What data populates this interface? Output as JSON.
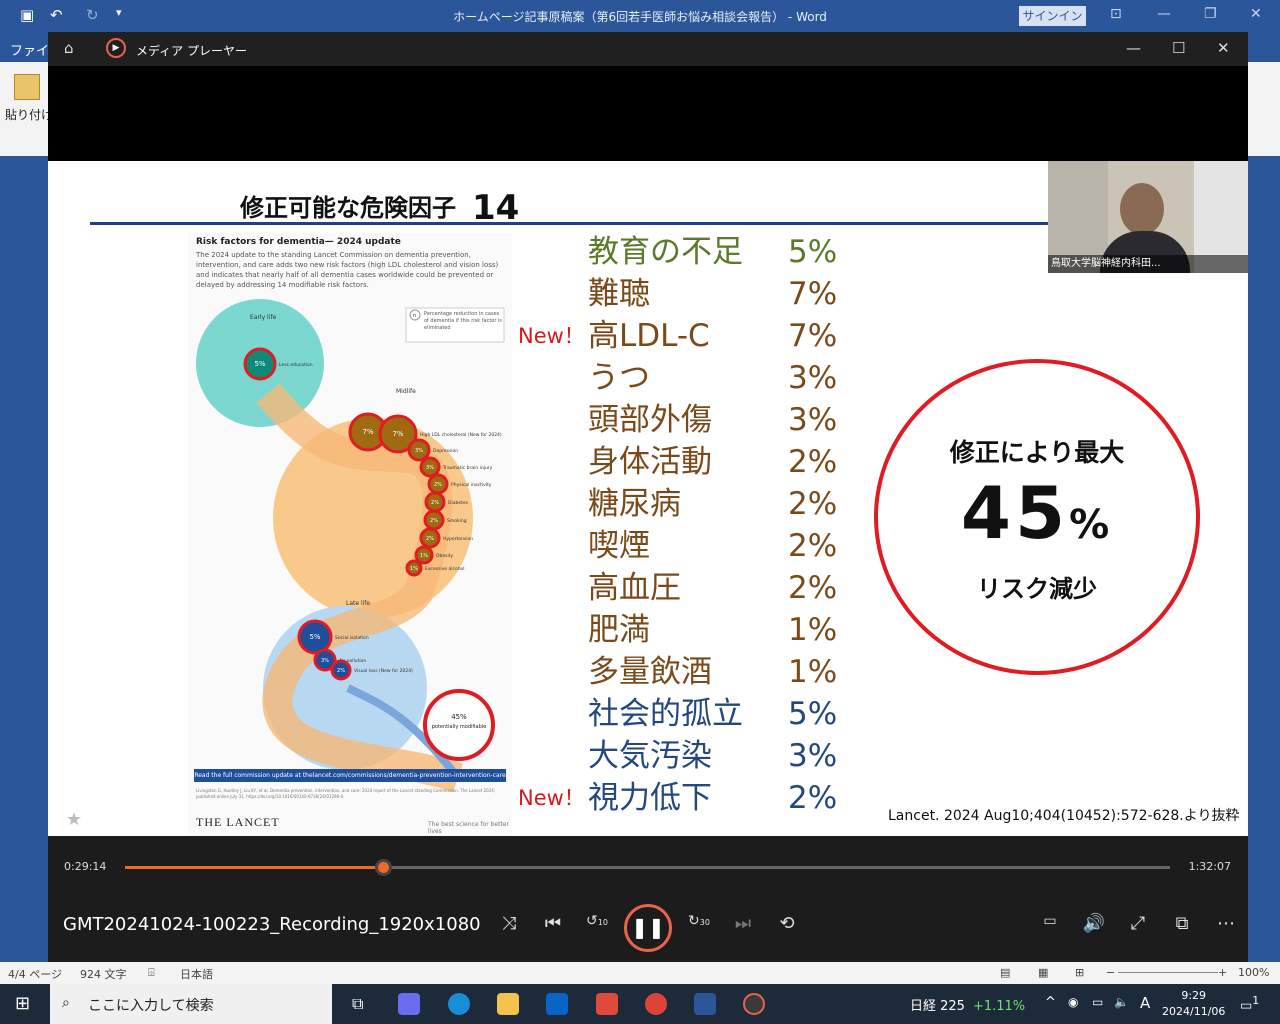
{
  "word": {
    "title": "ホームページ記事原稿案（第6回若手医師お悩み相談会報告） - Word",
    "signin": "サインイン",
    "tab_file": "ファイル",
    "paste_label": "貼り付け",
    "status": {
      "page": "4/4 ページ",
      "words": "924 文字",
      "lang": "日本語",
      "zoom": "100%"
    }
  },
  "player": {
    "app_name": "メディア プレーヤー",
    "file_name": "GMT20241024-100223_Recording_1920x1080",
    "time_current": "0:29:14",
    "time_total": "1:32:07",
    "progress": 0.2465,
    "skip_back": "10",
    "skip_fwd": "30"
  },
  "slide": {
    "title": "修正可能な危険因子",
    "title_number": "14",
    "factors": [
      {
        "new": "",
        "name": "教育の不足",
        "pct": "5%",
        "color": "#5a7a2a"
      },
      {
        "new": "",
        "name": "難聴",
        "pct": "7%",
        "color": "#7b4a1a"
      },
      {
        "new": "New！",
        "name": "高LDL-C",
        "pct": "7%",
        "color": "#7b4a1a"
      },
      {
        "new": "",
        "name": "うつ",
        "pct": "3%",
        "color": "#7b4a1a"
      },
      {
        "new": "",
        "name": "頭部外傷",
        "pct": "3%",
        "color": "#7b4a1a"
      },
      {
        "new": "",
        "name": "身体活動",
        "pct": "2%",
        "color": "#7b4a1a"
      },
      {
        "new": "",
        "name": "糖尿病",
        "pct": "2%",
        "color": "#7b4a1a"
      },
      {
        "new": "",
        "name": "喫煙",
        "pct": "2%",
        "color": "#7b4a1a"
      },
      {
        "new": "",
        "name": "高血圧",
        "pct": "2%",
        "color": "#7b4a1a"
      },
      {
        "new": "",
        "name": "肥満",
        "pct": "1%",
        "color": "#7b4a1a"
      },
      {
        "new": "",
        "name": "多量飲酒",
        "pct": "1%",
        "color": "#7b4a1a"
      },
      {
        "new": "",
        "name": "社会的孤立",
        "pct": "5%",
        "color": "#24477f"
      },
      {
        "new": "",
        "name": "大気汚染",
        "pct": "3%",
        "color": "#24477f"
      },
      {
        "new": "New！",
        "name": "視力低下",
        "pct": "2%",
        "color": "#24477f"
      }
    ],
    "circle_line1": "修正により最大",
    "circle_big": "45",
    "circle_unit": "%",
    "circle_line3": "リスク減少",
    "citation": "Lancet. 2024 Aug10;404(10452):572-628.より抜粋",
    "webcam_name": "鳥取大学脳神経内科田..."
  },
  "infographic": {
    "heading": "Risk factors for dementia— 2024 update",
    "para": "The 2024 update to the standing Lancet Commission on dementia prevention, intervention, and care adds two new risk factors (high LDL cholesterol and vision loss) and indicates that nearly half of all dementia cases worldwide could be prevented or delayed by addressing 14 modifiable risk factors.",
    "legend": "Percentage reduction in cases of dementia if this risk factor is eliminated",
    "legend_mark": "n",
    "stage_early": "Early life",
    "stage_mid": "Midlife",
    "stage_late": "Late life",
    "bubbles": [
      {
        "v": "5%",
        "label": "Less education",
        "stage": "early"
      },
      {
        "v": "7%",
        "label": "Hearing loss",
        "stage": "mid"
      },
      {
        "v": "7%",
        "label": "High LDL cholesterol (New for 2024)",
        "stage": "mid"
      },
      {
        "v": "3%",
        "label": "Depression",
        "stage": "mid"
      },
      {
        "v": "3%",
        "label": "Traumatic brain injury",
        "stage": "mid"
      },
      {
        "v": "2%",
        "label": "Physical inactivity",
        "stage": "mid"
      },
      {
        "v": "2%",
        "label": "Diabetes",
        "stage": "mid"
      },
      {
        "v": "2%",
        "label": "Smoking",
        "stage": "mid"
      },
      {
        "v": "2%",
        "label": "Hypertension",
        "stage": "mid"
      },
      {
        "v": "1%",
        "label": "Obesity",
        "stage": "mid"
      },
      {
        "v": "1%",
        "label": "Excessive alcohol",
        "stage": "mid"
      },
      {
        "v": "5%",
        "label": "Social isolation",
        "stage": "late"
      },
      {
        "v": "3%",
        "label": "Air pollution",
        "stage": "late"
      },
      {
        "v": "2%",
        "label": "Visual loss (New for 2024)",
        "stage": "late"
      }
    ],
    "total_pct": "45%",
    "total_label": "potentially modifiable",
    "bar": "Read the full commission update at thelancet.com/commissions/dementia-prevention-intervention-care",
    "ref": "Livingston G, Huntley J, Liu KY, et al. Dementia prevention, intervention, and care: 2024 report of the Lancet standing Commission. The Lancet 2024; published online July 31. https://doi.org/10.1016/S0140-6736(24)01296-0.",
    "logo": "THE LANCET",
    "tag": "The best science for better lives"
  },
  "taskbar": {
    "search_placeholder": "ここに入力して検索",
    "nikkei_label": "日経 225",
    "nikkei_change": "+1.11%",
    "ime": "A",
    "time": "9:29",
    "date": "2024/11/06",
    "notif": "1"
  },
  "colors": {
    "accent": "#f06a25",
    "word_blue": "#2b579a",
    "circle_red": "#e01b22",
    "stage_early": "#7ad8d0",
    "stage_mid": "#f8c98a",
    "stage_late": "#b7d8f0"
  }
}
